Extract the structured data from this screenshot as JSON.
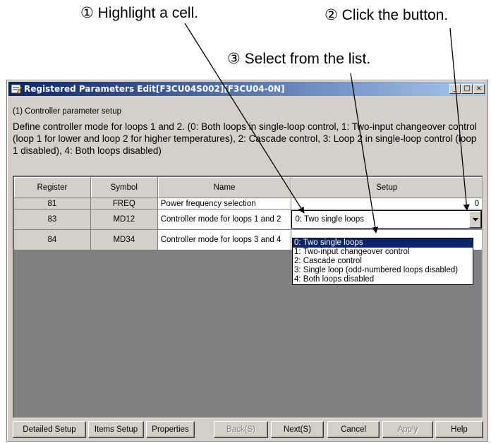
{
  "annotations": {
    "step1": "① Highlight a cell.",
    "step2": "② Click the button.",
    "step3": "③ Select from the list."
  },
  "window": {
    "title": "Registered Parameters Edit[F3CU04S002][F3CU04-0N]",
    "minimize": "_",
    "maximize": "□",
    "close": "×"
  },
  "section_label": "(1) Controller parameter setup",
  "description": "Define controller mode for loops 1 and 2. (0: Both loops in single-loop control, 1: Two-input changeover control (loop 1 for lower and loop 2 for higher temperatures), 2: Cascade control, 3: Loop 2 in single-loop control (loop 1 disabled), 4: Both loops disabled)",
  "grid": {
    "headers": [
      "Register",
      "Symbol",
      "Name",
      "Setup"
    ],
    "rows": [
      {
        "register": "81",
        "symbol": "FREQ",
        "name": "Power frequency selection",
        "setup": "0"
      },
      {
        "register": "83",
        "symbol": "MD12",
        "name": "Controller mode for loops 1 and 2",
        "setup": "0: Two single loops"
      },
      {
        "register": "84",
        "symbol": "MD34",
        "name": "Controller mode for loops 3 and 4",
        "setup": ""
      }
    ]
  },
  "dropdown": {
    "options": [
      "0: Two single loops",
      "1: Two-input changeover control",
      "2: Cascade control",
      "3: Single loop (odd-numbered loops disabled)",
      "4: Both loops disabled"
    ],
    "selected_index": 0
  },
  "buttons": {
    "detailed_setup": "Detailed Setup",
    "items_setup": "Items Setup",
    "properties": "Properties",
    "back": "Back(S)",
    "next": "Next(S)",
    "cancel": "Cancel",
    "apply": "Apply",
    "help": "Help"
  }
}
